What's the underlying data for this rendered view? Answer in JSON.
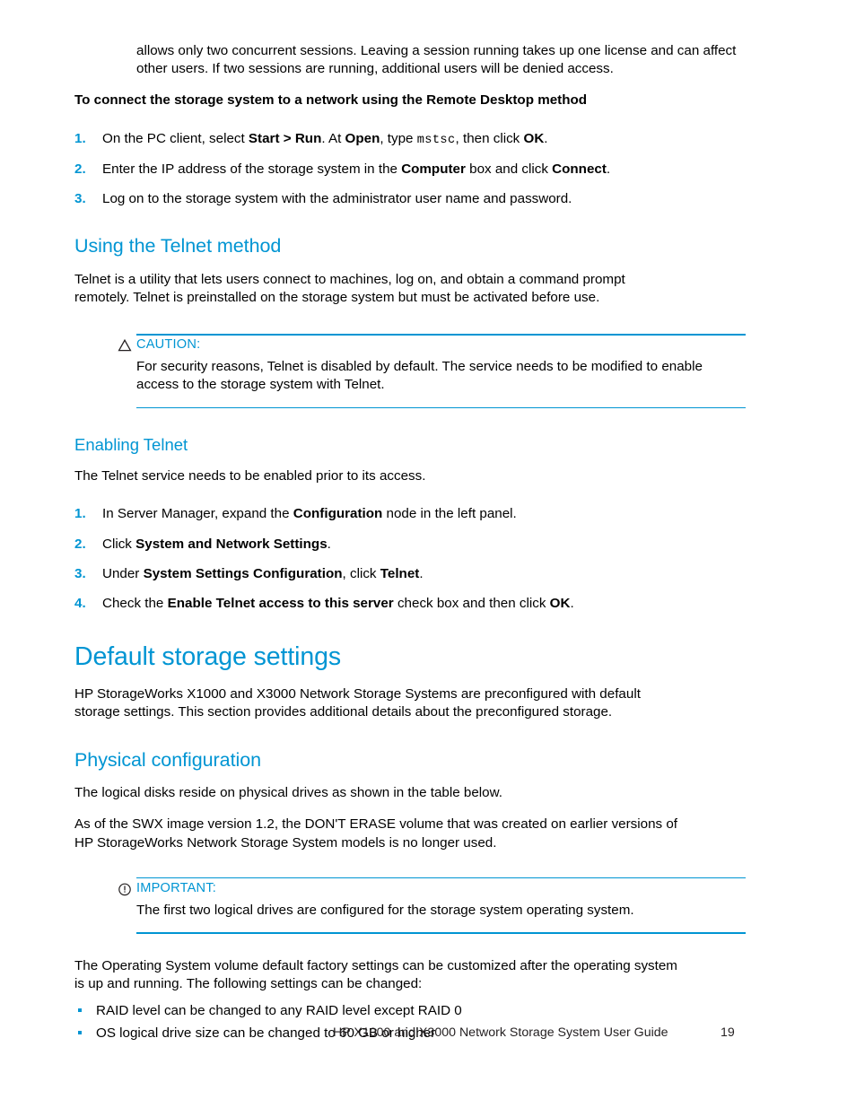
{
  "document": {
    "intro_paragraph": "allows only two concurrent sessions. Leaving a session running takes up one license and can affect other users. If two sessions are running, additional users will be denied access.",
    "remote_desktop": {
      "procedure_title": "To connect the storage system to a network using the Remote Desktop method",
      "steps": [
        {
          "number": "1.",
          "parts": [
            {
              "text": "On the PC client, select ",
              "style": "normal"
            },
            {
              "text": "Start > Run",
              "style": "bold"
            },
            {
              "text": ". At ",
              "style": "normal"
            },
            {
              "text": "Open",
              "style": "bold"
            },
            {
              "text": ", type ",
              "style": "normal"
            },
            {
              "text": "mstsc",
              "style": "mono"
            },
            {
              "text": ", then click ",
              "style": "normal"
            },
            {
              "text": "OK",
              "style": "bold"
            },
            {
              "text": ".",
              "style": "normal"
            }
          ]
        },
        {
          "number": "2.",
          "parts": [
            {
              "text": "Enter the IP address of the storage system in the ",
              "style": "normal"
            },
            {
              "text": "Computer",
              "style": "bold"
            },
            {
              "text": " box and click ",
              "style": "normal"
            },
            {
              "text": "Connect",
              "style": "bold"
            },
            {
              "text": ".",
              "style": "normal"
            }
          ]
        },
        {
          "number": "3.",
          "parts": [
            {
              "text": "Log on to the storage system with the administrator user name and password.",
              "style": "normal"
            }
          ]
        }
      ]
    },
    "telnet_method": {
      "heading": "Using the Telnet method",
      "paragraph": "Telnet is a utility that lets users connect to machines, log on, and obtain a command prompt remotely. Telnet is preinstalled on the storage system but must be activated before use.",
      "caution": {
        "icon": "caution-triangle-icon",
        "label": "CAUTION:",
        "text": "For security reasons, Telnet is disabled by default. The service needs to be modified to enable access to the storage system with Telnet."
      }
    },
    "enabling_telnet": {
      "heading": "Enabling Telnet",
      "paragraph": "The Telnet service needs to be enabled prior to its access.",
      "steps": [
        {
          "number": "1.",
          "parts": [
            {
              "text": "In Server Manager, expand the ",
              "style": "normal"
            },
            {
              "text": "Configuration",
              "style": "bold"
            },
            {
              "text": " node in the left panel.",
              "style": "normal"
            }
          ]
        },
        {
          "number": "2.",
          "parts": [
            {
              "text": "Click ",
              "style": "normal"
            },
            {
              "text": "System and Network Settings",
              "style": "bold"
            },
            {
              "text": ".",
              "style": "normal"
            }
          ]
        },
        {
          "number": "3.",
          "parts": [
            {
              "text": "Under ",
              "style": "normal"
            },
            {
              "text": "System Settings Configuration",
              "style": "bold"
            },
            {
              "text": ", click ",
              "style": "normal"
            },
            {
              "text": "Telnet",
              "style": "bold"
            },
            {
              "text": ".",
              "style": "normal"
            }
          ]
        },
        {
          "number": "4.",
          "parts": [
            {
              "text": "Check the ",
              "style": "normal"
            },
            {
              "text": "Enable Telnet access to this server",
              "style": "bold"
            },
            {
              "text": " check box and then click ",
              "style": "normal"
            },
            {
              "text": "OK",
              "style": "bold"
            },
            {
              "text": ".",
              "style": "normal"
            }
          ]
        }
      ]
    },
    "default_storage_settings": {
      "heading": "Default storage settings",
      "paragraph": "HP StorageWorks X1000 and X3000 Network Storage Systems are preconfigured with default storage settings. This section provides additional details about the preconfigured storage."
    },
    "physical_configuration": {
      "heading": "Physical configuration",
      "paragraph1": "The logical disks reside on physical drives as shown in the table below.",
      "paragraph2": "As of the SWX image version 1.2, the DON'T ERASE volume that was created on earlier versions of HP StorageWorks Network Storage System models is no longer used.",
      "important": {
        "icon": "important-circle-icon",
        "label": "IMPORTANT:",
        "text": "The first two logical drives are configured for the storage system operating system."
      },
      "closing_paragraph": "The Operating System volume default factory settings can be customized after the operating system is up and running. The following settings can be changed:",
      "bullets": [
        "RAID level can be changed to any RAID level except RAID 0",
        "OS logical drive size can be changed to 60 GB or higher"
      ]
    },
    "footer": {
      "title": "HP X1000 and X3000 Network Storage System User Guide",
      "page_number": "19"
    },
    "colors": {
      "heading_blue": "#0095d3",
      "rule_blue": "#0095d3",
      "body_black": "#000000"
    }
  }
}
